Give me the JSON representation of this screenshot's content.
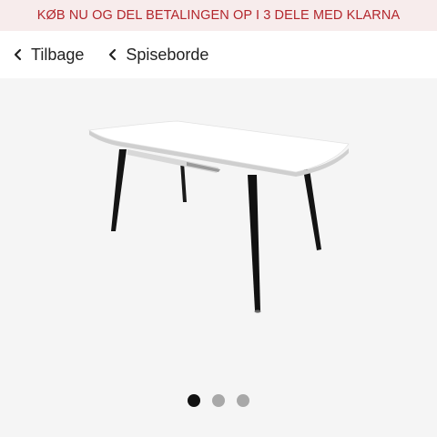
{
  "banner": {
    "text": "KØB NU OG DEL BETALINGEN OP I 3 DELE MED KLARNA"
  },
  "nav": {
    "back_label": "Tilbage",
    "category_label": "Spiseborde",
    "icon": "chevron-left-icon"
  },
  "gallery": {
    "image": "dining-table-white-top-black-legs",
    "active_index": 0,
    "dots": [
      {
        "color": "#111111"
      },
      {
        "color": "#a8a8a8"
      },
      {
        "color": "#a8a8a8"
      }
    ]
  },
  "colors": {
    "banner_bg": "#f7ecec",
    "banner_text": "#b3262c",
    "gallery_bg": "#f5f5f5"
  }
}
